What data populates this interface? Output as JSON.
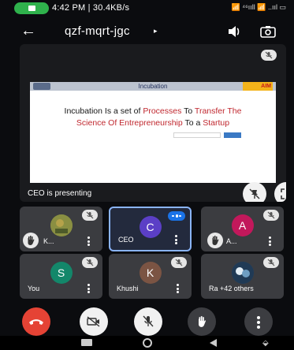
{
  "status_bar": {
    "time_speed": "4:42 PM | 30.4KB/s",
    "right_icons": "📶 ⁴⁶ııll 📶 ..ııl ▭"
  },
  "header": {
    "meeting_code": "qzf-mqrt-jgc",
    "caret": "▸"
  },
  "presentation": {
    "caption": "CEO is presenting",
    "slide": {
      "title": "Incubation",
      "logo_right": "AIM",
      "line1_a": "Incubation Is a set of ",
      "line1_b": "Processes",
      "line1_c": " To ",
      "line1_d": "Transfer The",
      "line2_a": "Science Of Entrepreneurship",
      "line2_b": " To a ",
      "line2_c": "Startup"
    }
  },
  "tiles": [
    {
      "name": "K...",
      "avatar_letter": "",
      "avatar_color": "#6b7a3c",
      "muted": true,
      "hand_raised": true,
      "speaking": false
    },
    {
      "name": "CEO",
      "avatar_letter": "C",
      "avatar_color": "#5b3fc6",
      "muted": false,
      "hand_raised": false,
      "speaking": true
    },
    {
      "name": "A...",
      "avatar_letter": "A",
      "avatar_color": "#c2185b",
      "muted": true,
      "hand_raised": true,
      "speaking": false
    },
    {
      "name": "You",
      "avatar_letter": "S",
      "avatar_color": "#13876a",
      "muted": true,
      "hand_raised": false,
      "speaking": false
    },
    {
      "name": "Khushi",
      "avatar_letter": "K",
      "avatar_color": "#7b5443",
      "muted": true,
      "hand_raised": false,
      "speaking": false
    },
    {
      "name": "Ra +42 others",
      "avatar_letter": "",
      "avatar_color": "#2f4f6f",
      "muted": true,
      "hand_raised": false,
      "speaking": false
    }
  ],
  "colors": {
    "end_call": "#e54335",
    "accent": "#8ab4f8",
    "tile_bg": "#3b3c40"
  }
}
